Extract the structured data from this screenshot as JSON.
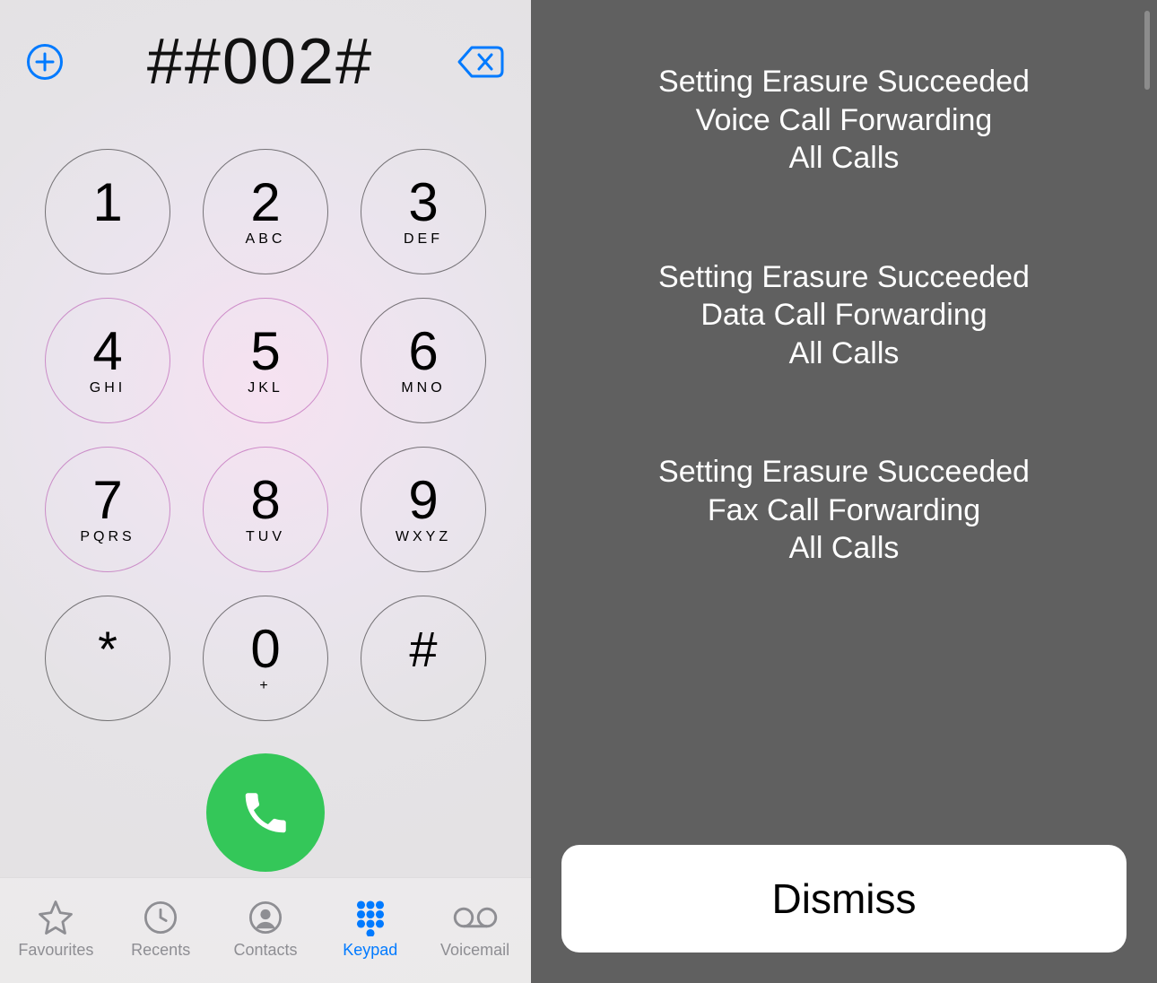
{
  "dialer": {
    "entered": "##002#",
    "keys": [
      {
        "digit": "1",
        "letters": "",
        "tinted": false
      },
      {
        "digit": "2",
        "letters": "ABC",
        "tinted": false
      },
      {
        "digit": "3",
        "letters": "DEF",
        "tinted": false
      },
      {
        "digit": "4",
        "letters": "GHI",
        "tinted": true
      },
      {
        "digit": "5",
        "letters": "JKL",
        "tinted": true
      },
      {
        "digit": "6",
        "letters": "MNO",
        "tinted": false
      },
      {
        "digit": "7",
        "letters": "PQRS",
        "tinted": true
      },
      {
        "digit": "8",
        "letters": "TUV",
        "tinted": true
      },
      {
        "digit": "9",
        "letters": "WXYZ",
        "tinted": false
      },
      {
        "digit": "*",
        "letters": "",
        "tinted": false,
        "sym": true
      },
      {
        "digit": "0",
        "letters": "+",
        "tinted": false
      },
      {
        "digit": "#",
        "letters": "",
        "tinted": false,
        "sym": true
      }
    ]
  },
  "tabs": {
    "items": [
      {
        "id": "favourites",
        "label": "Favourites",
        "active": false
      },
      {
        "id": "recents",
        "label": "Recents",
        "active": false
      },
      {
        "id": "contacts",
        "label": "Contacts",
        "active": false
      },
      {
        "id": "keypad",
        "label": "Keypad",
        "active": true
      },
      {
        "id": "voicemail",
        "label": "Voicemail",
        "active": false
      }
    ]
  },
  "result": {
    "messages": [
      {
        "line1": "Setting Erasure Succeeded",
        "line2": "Voice Call Forwarding",
        "line3": "All Calls"
      },
      {
        "line1": "Setting Erasure Succeeded",
        "line2": "Data Call Forwarding",
        "line3": "All Calls"
      },
      {
        "line1": "Setting Erasure Succeeded",
        "line2": "Fax Call Forwarding",
        "line3": "All Calls"
      }
    ],
    "dismiss_label": "Dismiss"
  },
  "colors": {
    "accent": "#007aff",
    "call_green": "#34c759",
    "overlay_bg": "#606060"
  }
}
